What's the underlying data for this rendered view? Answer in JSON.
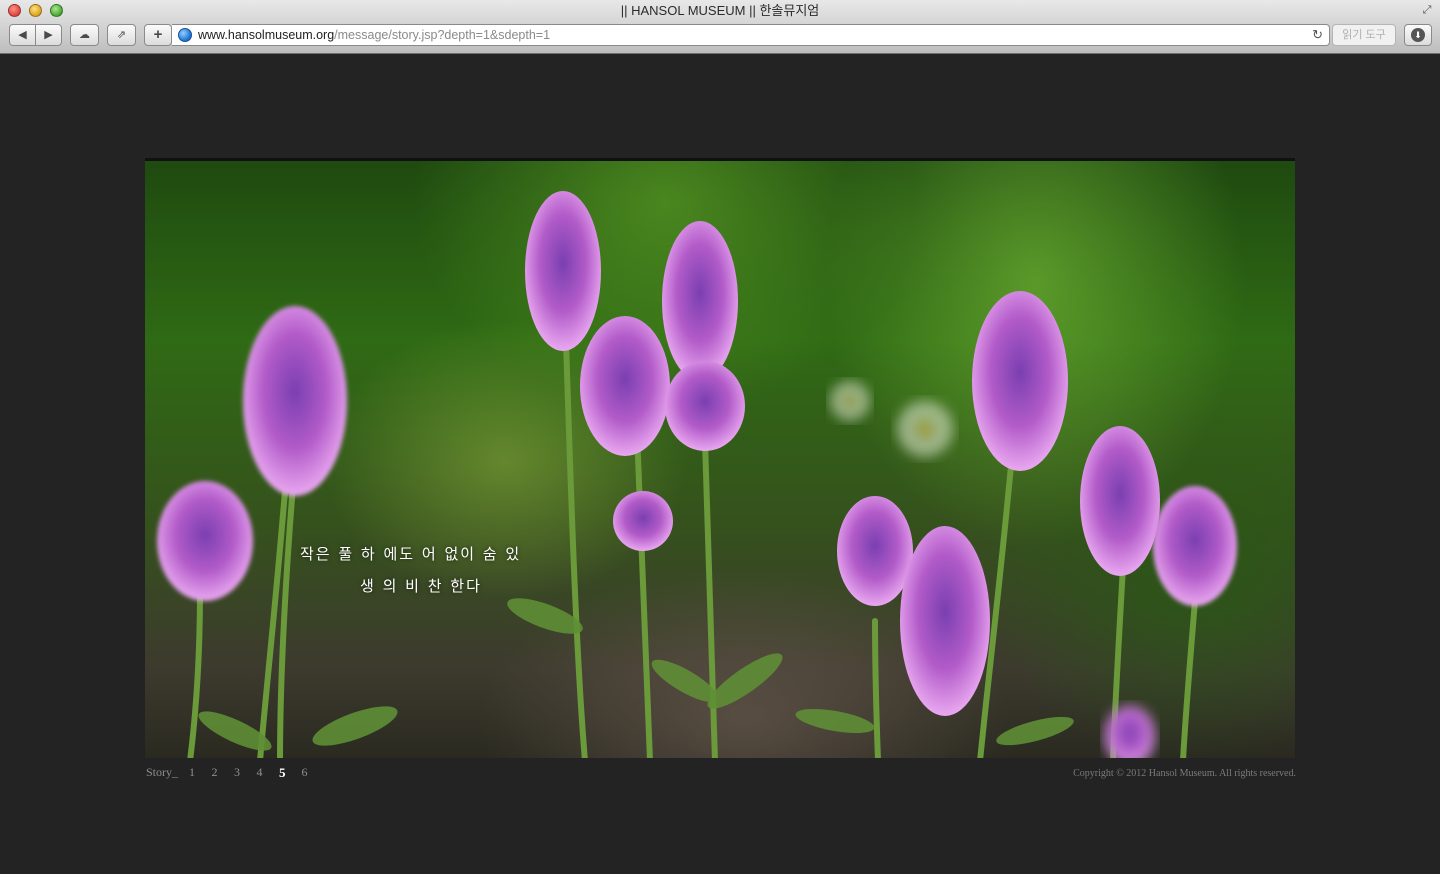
{
  "window": {
    "title": "|| HANSOL MUSEUM || 한솔뮤지엄"
  },
  "toolbar": {
    "back_label": "◀",
    "forward_label": "▶",
    "cloud_label": "☁",
    "share_label": "⇗",
    "add_label": "+",
    "reader_label": "읽기 도구",
    "download_label": "⬇",
    "resize_label": "⤢",
    "reload_label": "↻"
  },
  "address": {
    "host": "www.hansolmuseum.org",
    "path": "/message/story.jsp?depth=1&sdepth=1"
  },
  "story": {
    "line1": "작은 풀 하 에도 어 없이 숨 있",
    "line2": "생 의 비 찬 한다"
  },
  "pager": {
    "label": "Story_",
    "pages": [
      "1",
      "2",
      "3",
      "4",
      "5",
      "6"
    ],
    "active": "5"
  },
  "footer": {
    "copyright": "Copyright © 2012 Hansol Museum. All rights reserved."
  },
  "colors": {
    "page_bg": "#232323",
    "flower": "#b25bc9",
    "stem": "#6a9a3a"
  }
}
